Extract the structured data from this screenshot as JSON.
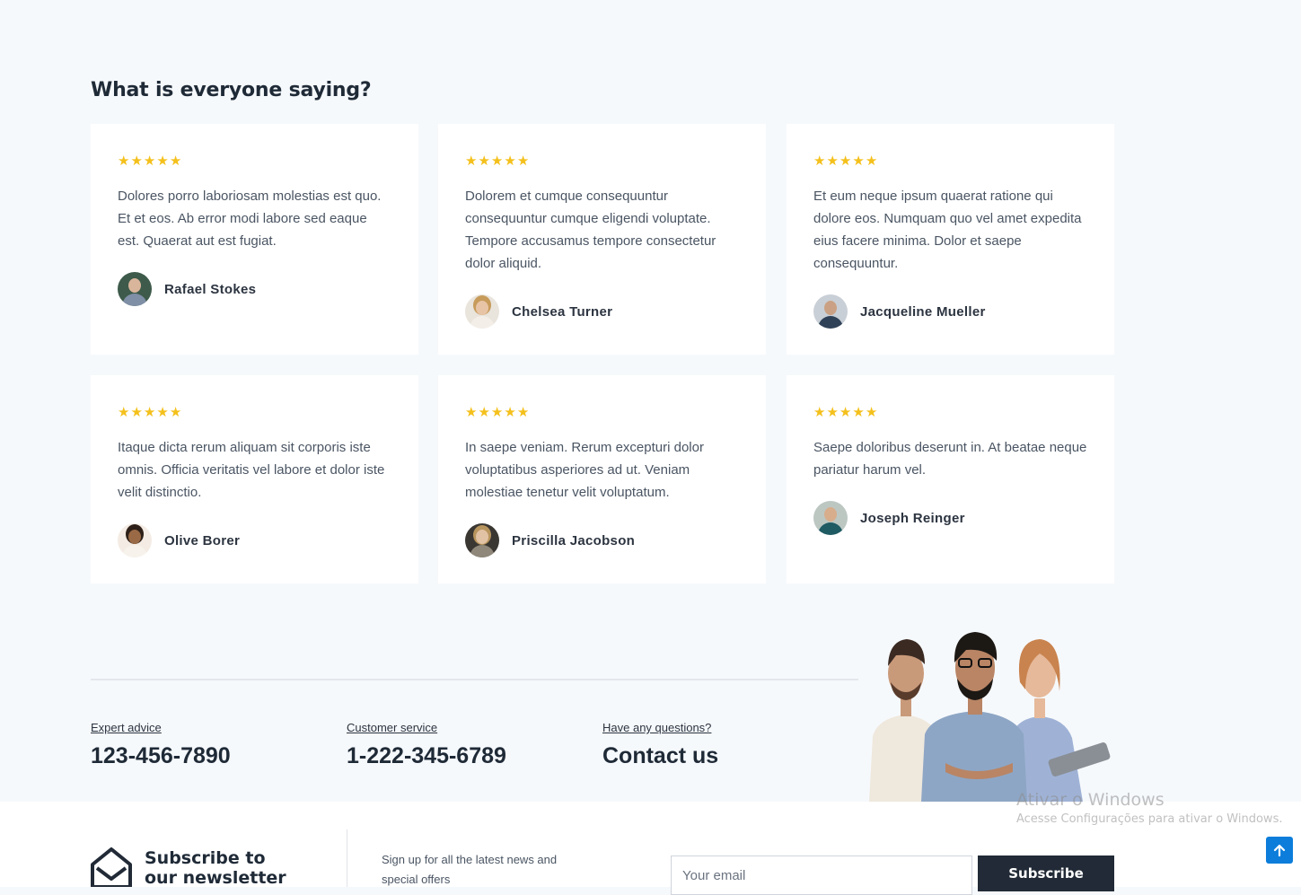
{
  "testimonials": {
    "heading": "What is everyone saying?",
    "star_glyph": "★",
    "items": [
      {
        "rating": 5,
        "quote": "Dolores porro laboriosam molestias est quo. Et et eos. Ab error modi labore sed eaque est. Quaerat aut est fugiat.",
        "name": "Rafael Stokes"
      },
      {
        "rating": 5,
        "quote": "Dolorem et cumque consequuntur consequuntur cumque eligendi voluptate. Tempore accusamus tempore consectetur dolor aliquid.",
        "name": "Chelsea Turner"
      },
      {
        "rating": 5,
        "quote": "Et eum neque ipsum quaerat ratione qui dolore eos. Numquam quo vel amet expedita eius facere minima. Dolor et saepe consequuntur.",
        "name": "Jacqueline Mueller"
      },
      {
        "rating": 5,
        "quote": "Itaque dicta rerum aliquam sit corporis iste omnis. Officia veritatis vel labore et dolor iste velit distinctio.",
        "name": "Olive Borer"
      },
      {
        "rating": 5,
        "quote": "In saepe veniam. Rerum excepturi dolor voluptatibus asperiores ad ut. Veniam molestiae tenetur velit voluptatum.",
        "name": "Priscilla Jacobson"
      },
      {
        "rating": 5,
        "quote": "Saepe doloribus deserunt in. At beatae neque pariatur harum vel.",
        "name": "Joseph Reinger"
      }
    ]
  },
  "contacts": [
    {
      "label": "Expert advice",
      "value": "123-456-7890"
    },
    {
      "label": "Customer service",
      "value": "1-222-345-6789"
    },
    {
      "label": "Have any questions?",
      "value": "Contact us"
    }
  ],
  "newsletter": {
    "title_line1": "Subscribe to",
    "title_line2": "our newsletter",
    "text": "Sign up for all the latest news and special offers",
    "placeholder": "Your email",
    "button": "Subscribe"
  },
  "watermark": {
    "title": "Ativar o Windows",
    "subtitle": "Acesse Configurações para ativar o Windows."
  },
  "colors": {
    "star": "#f4c01b",
    "dark": "#212a36",
    "scroll_button": "#0c7ddb"
  },
  "icons": {
    "newsletter": "envelope-open-icon",
    "scroll_top": "arrow-up-icon"
  }
}
